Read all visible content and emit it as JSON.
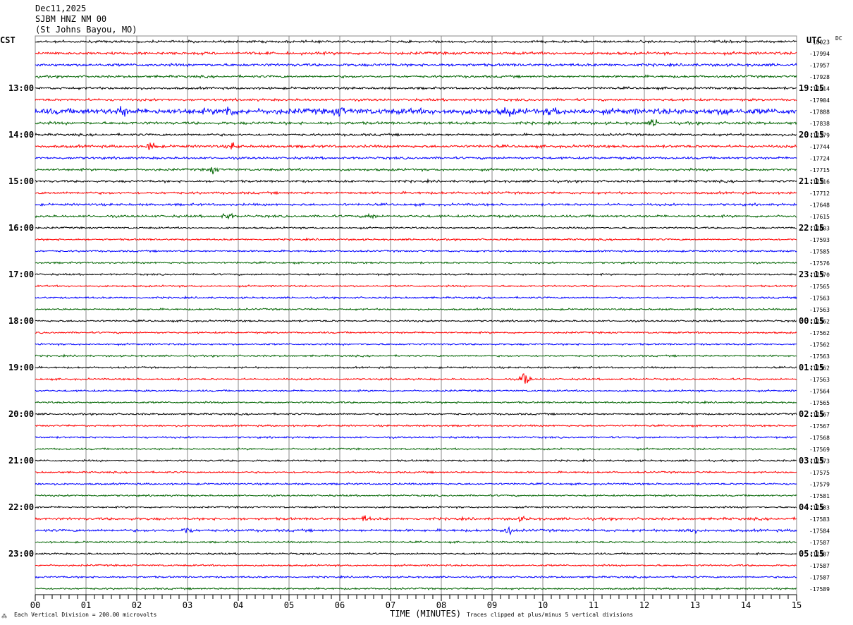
{
  "header": {
    "date": "Dec11,2025",
    "station": "SJBM HNZ NM 00",
    "location": "(St Johns Bayou, MO)"
  },
  "left_timezone": "CST",
  "right_timezone": "UTC",
  "dc_header": "DC",
  "footer": {
    "scale_note": "Each Vertical Division =  200.00 microvolts",
    "xlabel": "TIME (MINUTES)",
    "clip_note": "Traces clipped at plus/minus 5 vertical divisions"
  },
  "colors": [
    "#000000",
    "#ff0000",
    "#0000ff",
    "#006400"
  ],
  "chart_data": {
    "type": "line",
    "title": "",
    "xlabel": "TIME (MINUTES)",
    "xlim": [
      0,
      15
    ],
    "x_ticks": [
      "00",
      "01",
      "02",
      "03",
      "04",
      "05",
      "06",
      "07",
      "08",
      "09",
      "10",
      "11",
      "12",
      "13",
      "14",
      "15"
    ],
    "grid": true,
    "cst_labels": [
      "13:00",
      "14:00",
      "15:00",
      "16:00",
      "17:00",
      "18:00",
      "19:00",
      "20:00",
      "21:00",
      "22:00",
      "23:00"
    ],
    "utc_labels": [
      "19:15",
      "20:15",
      "21:15",
      "22:15",
      "23:15",
      "00:15",
      "01:15",
      "02:15",
      "03:15",
      "04:15",
      "05:15"
    ],
    "dc_offsets": [
      -18023,
      -17994,
      -17957,
      -17928,
      -17914,
      -17904,
      -17888,
      -17838,
      -17779,
      -17744,
      -17724,
      -17715,
      -17716,
      -17712,
      -17648,
      -17615,
      -17603,
      -17593,
      -17585,
      -17576,
      -17570,
      -17565,
      -17563,
      -17563,
      -17562,
      -17562,
      -17562,
      -17563,
      -17562,
      -17563,
      -17564,
      -17565,
      -17567,
      -17567,
      -17568,
      -17569,
      -17573,
      -17575,
      -17579,
      -17581,
      -17583,
      -17583,
      -17584,
      -17587,
      -17587,
      -17587,
      -17587,
      -17589
    ]
  }
}
